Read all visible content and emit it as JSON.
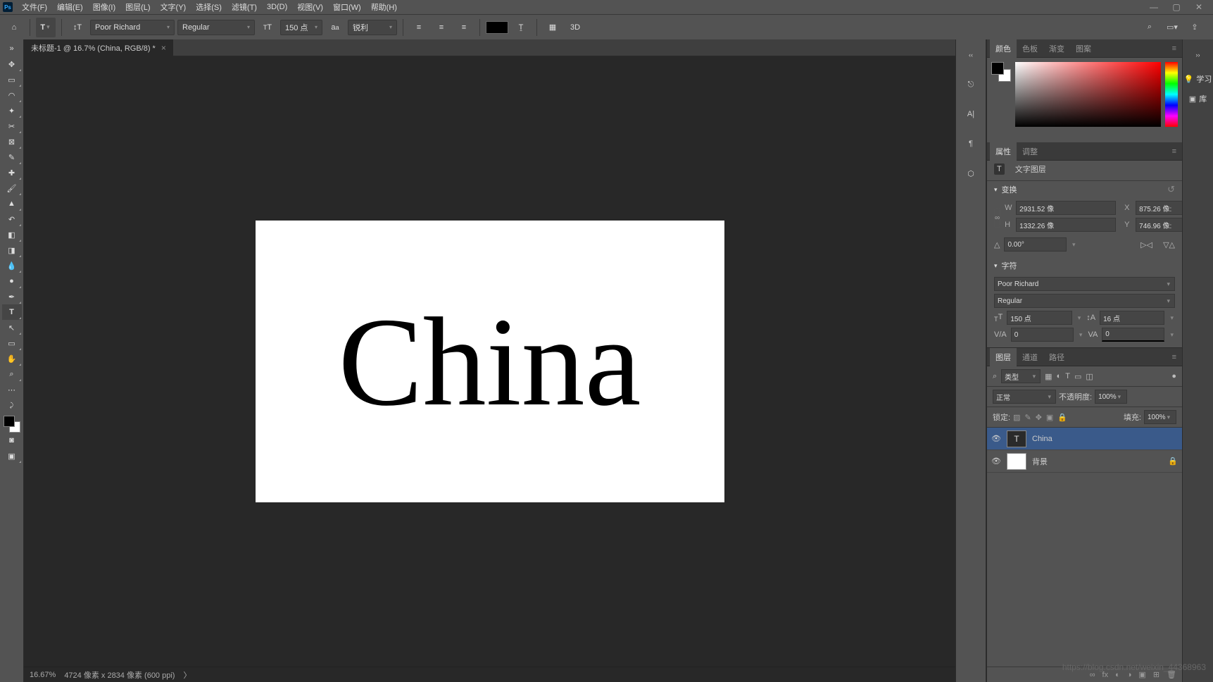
{
  "menu": {
    "file": "文件(F)",
    "edit": "编辑(E)",
    "image": "图像(I)",
    "layer": "图层(L)",
    "type": "文字(Y)",
    "select": "选择(S)",
    "filter": "滤镜(T)",
    "threed": "3D(D)",
    "view": "视图(V)",
    "window": "窗口(W)",
    "help": "帮助(H)"
  },
  "options": {
    "font_family": "Poor Richard",
    "font_style": "Regular",
    "font_size": "150 点",
    "antialias": "锐利",
    "threed": "3D"
  },
  "tab": {
    "title": "未标题-1 @ 16.7% (China, RGB/8) *"
  },
  "canvas": {
    "text": "China"
  },
  "status": {
    "zoom": "16.67%",
    "dims": "4724 像素 x 2834 像素 (600 ppi)",
    "arrow": "〉"
  },
  "panel_tabs": {
    "color": "颜色",
    "swatches": "色板",
    "gradients": "渐变",
    "patterns": "图案",
    "properties": "属性",
    "adjustments": "调整",
    "layers": "图层",
    "channels": "通道",
    "paths": "路径"
  },
  "learn": "学习",
  "library": "库",
  "properties": {
    "title": "文字图层",
    "transform": "变换",
    "W": "2931.52 像",
    "H": "1332.26 像",
    "X": "875.26 像:",
    "Y": "746.96 像:",
    "angle": "0.00°",
    "character": "字符",
    "font": "Poor Richard",
    "style": "Regular",
    "size": "150 点",
    "leading": "16 点",
    "tracking_va": "0",
    "tracking": "0"
  },
  "layers": {
    "type_filter": "类型",
    "blend": "正常",
    "opacity_label": "不透明度:",
    "opacity": "100%",
    "lock_label": "锁定:",
    "fill_label": "填充:",
    "fill": "100%",
    "layer1": "China",
    "layer2": "背景"
  },
  "watermark": "https://blog.csdn.net/weixin_44368963"
}
